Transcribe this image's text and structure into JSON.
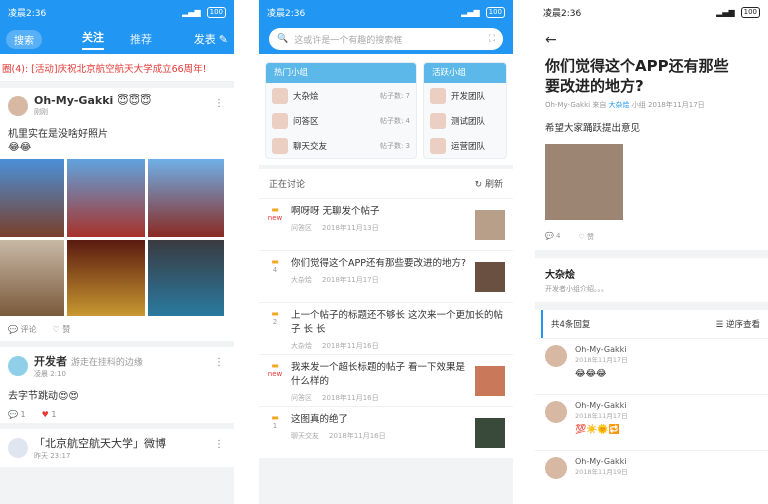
{
  "status_time": "凌晨2:36",
  "battery": "100",
  "feed": {
    "search_label": "搜索",
    "tabs": [
      "关注",
      "推荐"
    ],
    "post_label": "发表",
    "notice": "圈(4): [活动]庆祝北京航空航天大学成立66周年!",
    "post1": {
      "user": "Oh-My-Gakki 😇😇😇",
      "time": "刚刚",
      "text": "机里实在是没啥好照片",
      "emoji": "😂😂",
      "comment": "评论",
      "like": "赞"
    },
    "post2": {
      "user": "开发者",
      "subtitle": "游走在挂科的边缘",
      "time": "凌晨 2:10",
      "text": "去字节跳动😍😍",
      "comments": "1",
      "likes": "1"
    },
    "post3": {
      "user": "「北京航空航天大学」微博",
      "time": "昨天 23:17"
    }
  },
  "community": {
    "search_placeholder": "这或许是一个有趣的搜索框",
    "hot_title": "热门小组",
    "active_title": "活跃小组",
    "hot_groups": [
      {
        "name": "大杂烩",
        "count": "帖子数: 7"
      },
      {
        "name": "问答区",
        "count": "帖子数: 4"
      },
      {
        "name": "聊天交友",
        "count": "帖子数: 3"
      }
    ],
    "active_groups": [
      "开发团队",
      "测试团队",
      "运营团队"
    ],
    "discussing": "正在讨论",
    "refresh": "刷新",
    "threads": [
      {
        "title": "啊呀呀 无聊发个帖子",
        "group": "问答区",
        "date": "2018年11月13日",
        "tag": "new"
      },
      {
        "title": "你们觉得这个APP还有那些要改进的地方?",
        "group": "大杂烩",
        "date": "2018年11月17日",
        "tag": "4"
      },
      {
        "title": "上一个帖子的标题还不够长 这次来一个更加长的帖子 长 长",
        "group": "大杂烩",
        "date": "2018年11月16日",
        "tag": "2"
      },
      {
        "title": "我来发一个超长标题的帖子 看一下效果是什么样的",
        "group": "问答区",
        "date": "2018年11月16日",
        "tag": "new"
      },
      {
        "title": "这图真的绝了",
        "group": "聊天交友",
        "date": "2018年11月16日",
        "tag": "1"
      }
    ]
  },
  "detail": {
    "title": "你们觉得这个APP还有那些要改进的地方?",
    "author": "Oh-My-Gakki",
    "from": "来自",
    "group": "大杂烩",
    "group_suffix": "小组",
    "date": "2018年11月17日",
    "body": "希望大家踊跃提出意见",
    "comments": "4",
    "likes": "赞",
    "group_name": "大杂烩",
    "group_desc": "开发者小组介绍。。。",
    "replies_header": "共4条回复",
    "sort": "逆序查看",
    "replies": [
      {
        "name": "Oh-My-Gakki",
        "date": "2018年11月17日",
        "text": "😂😂😂"
      },
      {
        "name": "Oh-My-Gakki",
        "date": "2018年11月17日",
        "text": "💯☀️🌞🔁"
      },
      {
        "name": "Oh-My-Gakki",
        "date": "2018年11月19日",
        "text": ""
      }
    ]
  }
}
